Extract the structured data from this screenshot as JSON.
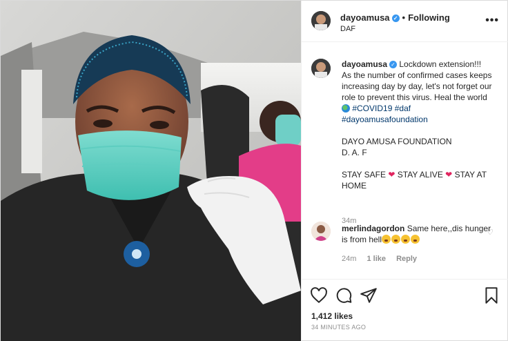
{
  "header": {
    "username": "dayoamusa",
    "separator": "•",
    "follow_status": "Following",
    "location": "DAF",
    "more_icon": "more-dots-icon"
  },
  "caption": {
    "username": "dayoamusa",
    "line1": "Lockdown extension!!!",
    "line2": "As the number of confirmed cases keeps increasing day by day, let's not forget our role to prevent this virus. Heal the world",
    "tag_covid": "#COVID19",
    "tag_daf": "#daf",
    "tag_foundation": "#dayoamusafoundation",
    "foundation_name": "DAYO AMUSA FOUNDATION",
    "foundation_abbr": "D. A. F",
    "stay_safe": "STAY SAFE",
    "stay_alive": "STAY ALIVE",
    "stay_at_home": "STAY AT HOME",
    "time": "34m"
  },
  "comment": {
    "username": "merlindagordon",
    "text": "Same here,,dis hunger is from hell",
    "time": "24m",
    "likes": "1 like",
    "reply": "Reply"
  },
  "actions": {
    "likes_count": "1,412 likes",
    "timestamp": "34 minutes ago"
  },
  "colors": {
    "verified": "#3897f0",
    "hashtag": "#00376b",
    "heart": "#e0245e",
    "secondary_text": "#8e8e8e"
  }
}
